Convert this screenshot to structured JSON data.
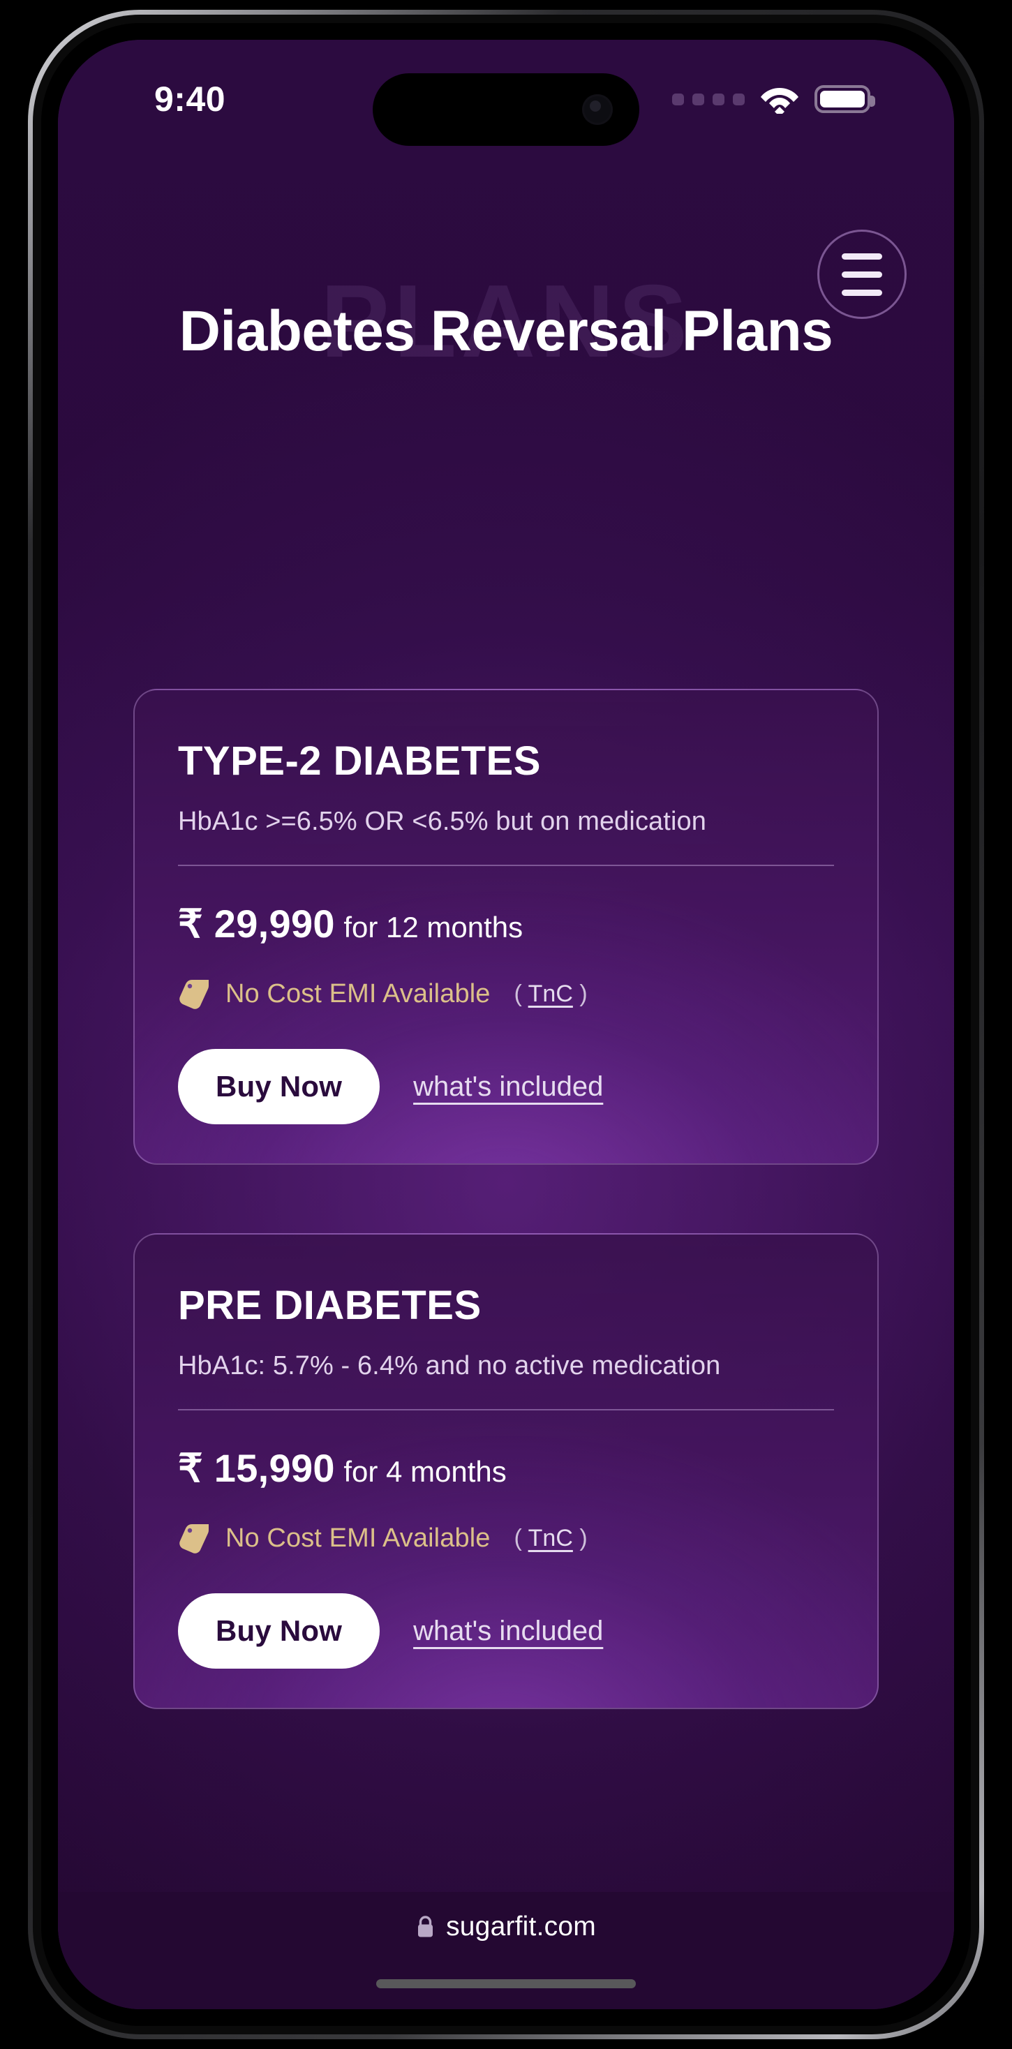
{
  "status_bar": {
    "time": "9:40",
    "signal_icon": "signal-dots-icon",
    "wifi_icon": "wifi-icon",
    "battery_icon": "battery-full-icon"
  },
  "header": {
    "menu_icon": "hamburger-menu-icon",
    "watermark": "PLANS",
    "title": "Diabetes Reversal Plans"
  },
  "plans": [
    {
      "title": "TYPE-2 DIABETES",
      "criteria": "HbA1c >=6.5% OR <6.5% but on medication",
      "price": "₹ 29,990",
      "term": "for 12 months",
      "emi_icon": "price-tag-icon",
      "emi_label": "No Cost EMI Available",
      "tnc_open": "(",
      "tnc_link": "TnC",
      "tnc_close": ")",
      "buy_label": "Buy Now",
      "included_label": "what's included"
    },
    {
      "title": "PRE DIABETES",
      "criteria": "HbA1c: 5.7% - 6.4% and no active medication",
      "price": "₹ 15,990",
      "term": "for 4 months",
      "emi_icon": "price-tag-icon",
      "emi_label": "No Cost EMI Available",
      "tnc_open": "(",
      "tnc_link": "TnC",
      "tnc_close": ")",
      "buy_label": "Buy Now",
      "included_label": "what's included"
    }
  ],
  "browser": {
    "lock_icon": "lock-icon",
    "url": "sugarfit.com"
  },
  "colors": {
    "page_bg": "#2c0b40",
    "card_border": "#bc96d6",
    "accent_gold": "#dcc089",
    "cta_bg": "#ffffff",
    "cta_text": "#2a0b3d",
    "browser_bar": "#240832"
  }
}
